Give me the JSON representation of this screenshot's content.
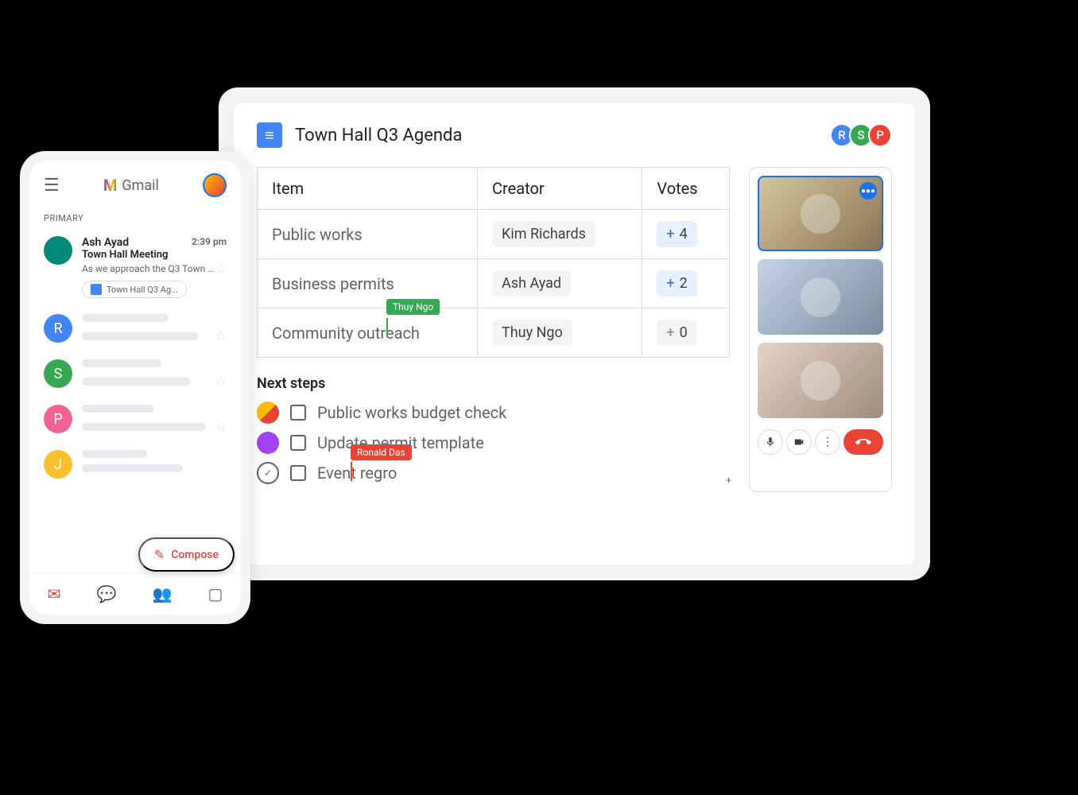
{
  "laptop": {
    "doc": {
      "title": "Town Hall Q3 Agenda",
      "collaborators": [
        {
          "initial": "R",
          "color": "blue"
        },
        {
          "initial": "S",
          "color": "green"
        },
        {
          "initial": "P",
          "color": "red"
        }
      ],
      "table": {
        "headers": {
          "item": "Item",
          "creator": "Creator",
          "votes": "Votes"
        },
        "rows": [
          {
            "item": "Public works",
            "creator": "Kim Richards",
            "votes": "4",
            "vote_class": ""
          },
          {
            "item": "Business permits",
            "creator": "Ash Ayad",
            "votes": "2",
            "vote_class": ""
          },
          {
            "item": "Community outreach",
            "creator": "Thuy Ngo",
            "votes": "0",
            "vote_class": "gray"
          }
        ]
      },
      "cursors": {
        "green": "Thuy Ngo",
        "red": "Ronald Das"
      },
      "next_steps": {
        "title": "Next steps",
        "items": [
          {
            "text": "Public works budget check"
          },
          {
            "text": "Update permit template"
          },
          {
            "text": "Event regro"
          }
        ]
      }
    },
    "video": {
      "controls": {
        "mic": "mic",
        "camera": "camera",
        "more": "more",
        "hangup": "hangup"
      }
    }
  },
  "phone": {
    "brand": "Gmail",
    "inbox_label": "PRIMARY",
    "featured_email": {
      "sender": "Ash Ayad",
      "time": "2:39 pm",
      "subject": "Town Hall Meeting",
      "preview": "As we approach the Q3 Town Ha...",
      "attachment": "Town Hall Q3 Ag..."
    },
    "placeholder_avatars": [
      "R",
      "S",
      "P",
      "J"
    ],
    "compose_label": "Compose"
  }
}
